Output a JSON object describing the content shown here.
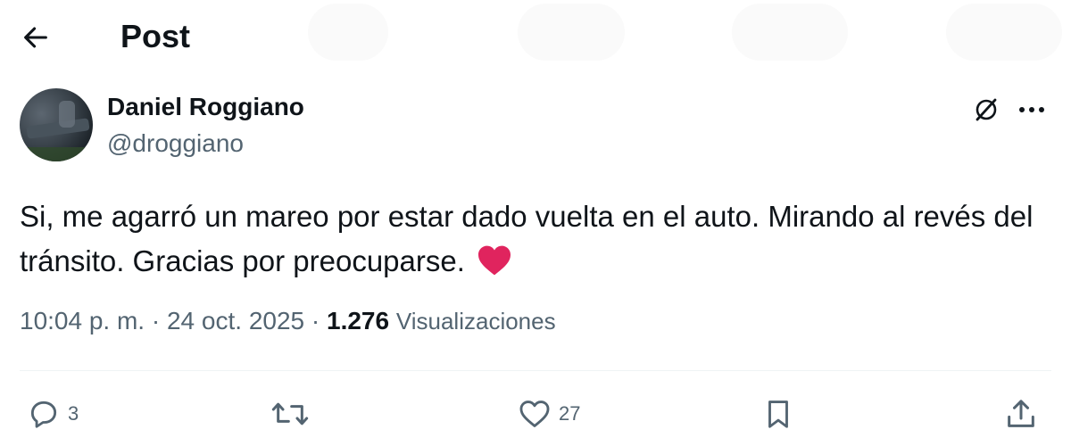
{
  "header": {
    "title": "Post",
    "back_icon": "arrow-left-icon"
  },
  "author": {
    "name": "Daniel Roggiano",
    "handle": "@droggiano",
    "avatar_icon": "avatar"
  },
  "tweet": {
    "text": "Si, me agarró un mareo por estar dado vuelta en el auto. Mirando al revés del tránsito. Gracias por preocuparse.",
    "emoji": "red-heart-emoji",
    "time": "10:04 p. m.",
    "date": "24 oct. 2025",
    "separator": "·",
    "views_count": "1.276",
    "views_label": "Visualizaciones"
  },
  "actions": {
    "reply": {
      "icon": "reply-icon",
      "count": "3"
    },
    "retweet": {
      "icon": "retweet-icon",
      "count": ""
    },
    "like": {
      "icon": "heart-icon",
      "count": "27"
    },
    "bookmark": {
      "icon": "bookmark-icon"
    },
    "share": {
      "icon": "share-icon"
    }
  },
  "top_right": {
    "grok_icon": "grok-icon",
    "more_icon": "more-icon"
  },
  "colors": {
    "text": "#0f1419",
    "secondary": "#536471",
    "heart": "#e0245e",
    "divider": "#eff3f4"
  }
}
